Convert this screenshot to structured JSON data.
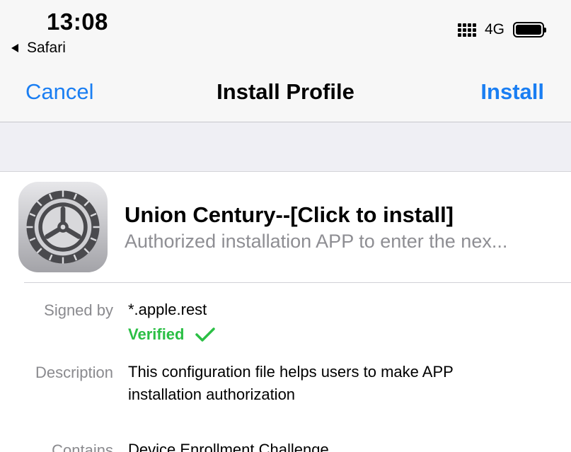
{
  "status_bar": {
    "time": "13:08",
    "back_app": "Safari",
    "network": "4G",
    "icons": [
      "signal-icon",
      "battery-icon"
    ]
  },
  "nav": {
    "cancel": "Cancel",
    "title": "Install Profile",
    "install": "Install"
  },
  "profile": {
    "icon": "settings-gear-icon",
    "name": "Union Century--[Click to install]",
    "subtitle": "Authorized installation APP to enter the nex..."
  },
  "details": {
    "signed_by_label": "Signed by",
    "signed_by_value": "*.apple.rest",
    "verified": "Verified",
    "description_label": "Description",
    "description_value": "This configuration file helps users to make APP installation authorization",
    "contains_label": "Contains",
    "contains_value": "Device Enrollment Challenge"
  },
  "colors": {
    "accent": "#1a7ef2",
    "verified": "#2bbf45",
    "secondary_text": "#8e8e93",
    "band": "#efeff4"
  }
}
